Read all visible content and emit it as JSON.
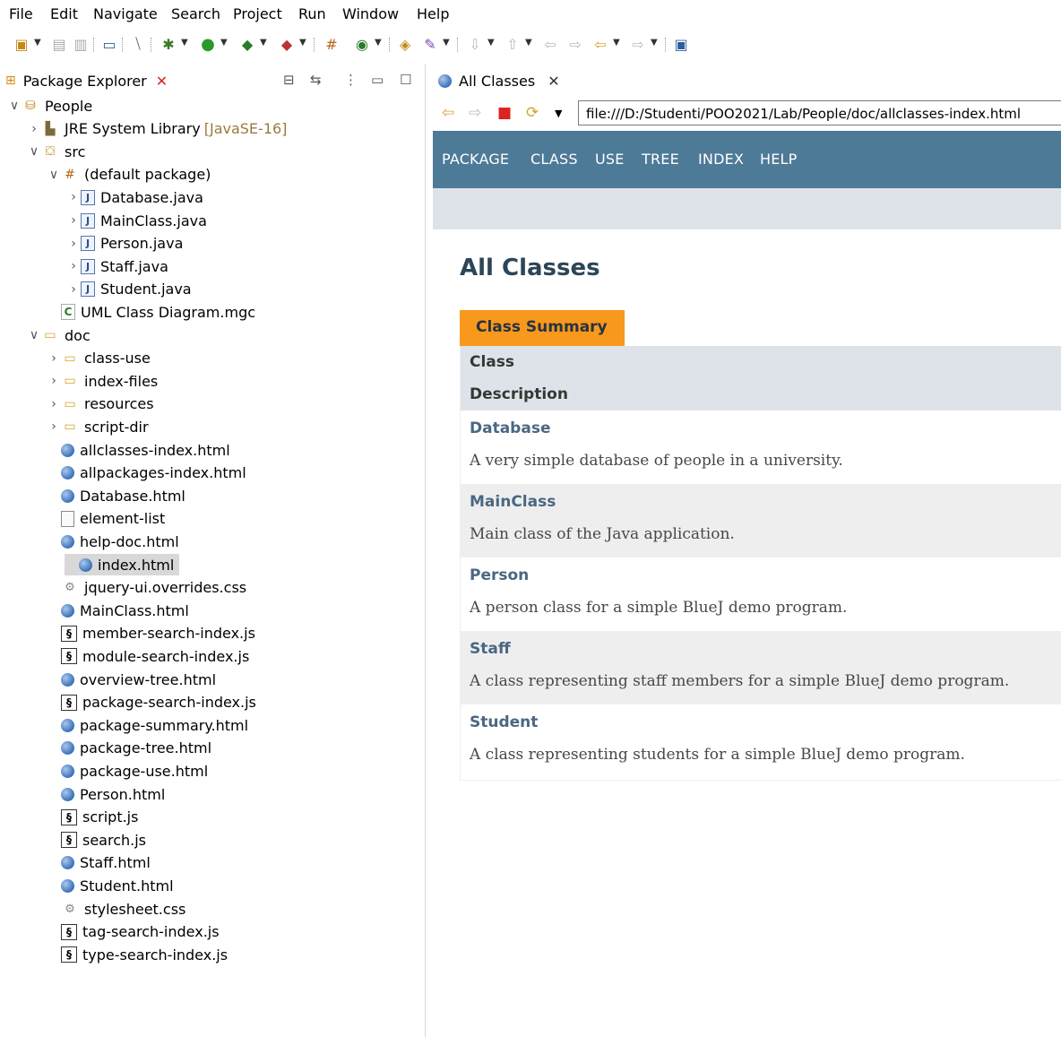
{
  "menu": [
    "File",
    "Edit",
    "Navigate",
    "Search",
    "Project",
    "Run",
    "Window",
    "Help"
  ],
  "package_explorer": {
    "title": "Package Explorer",
    "close": "✕",
    "tree": [
      {
        "label": "People",
        "icon": "project-icon",
        "depth": 0,
        "chevron": "expanded"
      },
      {
        "label": "JRE System Library",
        "extra": "[JavaSE-16]",
        "icon": "library-icon",
        "depth": 1,
        "chevron": "collapsed"
      },
      {
        "label": "src",
        "icon": "source-folder-icon",
        "depth": 1,
        "chevron": "expanded"
      },
      {
        "label": "(default package)",
        "icon": "package-icon",
        "depth": 2,
        "chevron": "expanded"
      },
      {
        "label": "Database.java",
        "icon": "java-file-icon",
        "depth": 3,
        "chevron": "collapsed"
      },
      {
        "label": "MainClass.java",
        "icon": "java-file-icon",
        "depth": 3,
        "chevron": "collapsed"
      },
      {
        "label": "Person.java",
        "icon": "java-file-icon",
        "depth": 3,
        "chevron": "collapsed"
      },
      {
        "label": "Staff.java",
        "icon": "java-file-icon",
        "depth": 3,
        "chevron": "collapsed"
      },
      {
        "label": "Student.java",
        "icon": "java-file-icon",
        "depth": 3,
        "chevron": "collapsed"
      },
      {
        "label": "UML Class Diagram.mgc",
        "icon": "diagram-file-icon",
        "depth": 2,
        "chevron": "none"
      },
      {
        "label": "doc",
        "icon": "folder-icon",
        "depth": 1,
        "chevron": "expanded"
      },
      {
        "label": "class-use",
        "icon": "folder-icon",
        "depth": 2,
        "chevron": "collapsed"
      },
      {
        "label": "index-files",
        "icon": "folder-icon",
        "depth": 2,
        "chevron": "collapsed"
      },
      {
        "label": "resources",
        "icon": "folder-icon",
        "depth": 2,
        "chevron": "collapsed"
      },
      {
        "label": "script-dir",
        "icon": "folder-icon",
        "depth": 2,
        "chevron": "collapsed"
      },
      {
        "label": "allclasses-index.html",
        "icon": "html-file-icon",
        "depth": 2,
        "chevron": "none"
      },
      {
        "label": "allpackages-index.html",
        "icon": "html-file-icon",
        "depth": 2,
        "chevron": "none"
      },
      {
        "label": "Database.html",
        "icon": "html-file-icon",
        "depth": 2,
        "chevron": "none"
      },
      {
        "label": "element-list",
        "icon": "text-file-icon",
        "depth": 2,
        "chevron": "none"
      },
      {
        "label": "help-doc.html",
        "icon": "html-file-icon",
        "depth": 2,
        "chevron": "none"
      },
      {
        "label": "index.html",
        "icon": "html-file-icon",
        "depth": 2,
        "chevron": "none",
        "selected": true
      },
      {
        "label": "jquery-ui.overrides.css",
        "icon": "css-file-icon",
        "depth": 2,
        "chevron": "none"
      },
      {
        "label": "MainClass.html",
        "icon": "html-file-icon",
        "depth": 2,
        "chevron": "none"
      },
      {
        "label": "member-search-index.js",
        "icon": "js-file-icon",
        "depth": 2,
        "chevron": "none"
      },
      {
        "label": "module-search-index.js",
        "icon": "js-file-icon",
        "depth": 2,
        "chevron": "none"
      },
      {
        "label": "overview-tree.html",
        "icon": "html-file-icon",
        "depth": 2,
        "chevron": "none"
      },
      {
        "label": "package-search-index.js",
        "icon": "js-file-icon",
        "depth": 2,
        "chevron": "none"
      },
      {
        "label": "package-summary.html",
        "icon": "html-file-icon",
        "depth": 2,
        "chevron": "none"
      },
      {
        "label": "package-tree.html",
        "icon": "html-file-icon",
        "depth": 2,
        "chevron": "none"
      },
      {
        "label": "package-use.html",
        "icon": "html-file-icon",
        "depth": 2,
        "chevron": "none"
      },
      {
        "label": "Person.html",
        "icon": "html-file-icon",
        "depth": 2,
        "chevron": "none"
      },
      {
        "label": "script.js",
        "icon": "js-file-icon",
        "depth": 2,
        "chevron": "none"
      },
      {
        "label": "search.js",
        "icon": "js-file-icon",
        "depth": 2,
        "chevron": "none"
      },
      {
        "label": "Staff.html",
        "icon": "html-file-icon",
        "depth": 2,
        "chevron": "none"
      },
      {
        "label": "Student.html",
        "icon": "html-file-icon",
        "depth": 2,
        "chevron": "none"
      },
      {
        "label": "stylesheet.css",
        "icon": "css-file-icon",
        "depth": 2,
        "chevron": "none"
      },
      {
        "label": "tag-search-index.js",
        "icon": "js-file-icon",
        "depth": 2,
        "chevron": "none"
      },
      {
        "label": "type-search-index.js",
        "icon": "js-file-icon",
        "depth": 2,
        "chevron": "none"
      }
    ]
  },
  "browser": {
    "tab_title": "All Classes",
    "tab_close": "✕",
    "url": "file:///D:/Studenti/POO2021/Lab/People/doc/allclasses-index.html",
    "nav_links": [
      "PACKAGE",
      "CLASS",
      "USE",
      "TREE",
      "INDEX",
      "HELP"
    ],
    "page_title": "All Classes",
    "caption": "Class Summary",
    "col_class": "Class",
    "col_description": "Description",
    "classes": [
      {
        "name": "Database",
        "description": "A very simple database of people in a university."
      },
      {
        "name": "MainClass",
        "description": "Main class of the Java application."
      },
      {
        "name": "Person",
        "description": "A person class for a simple BlueJ demo program."
      },
      {
        "name": "Staff",
        "description": "A class representing staff members for a simple BlueJ demo program."
      },
      {
        "name": "Student",
        "description": "A class representing students for a simple BlueJ demo program."
      }
    ]
  },
  "colors": {
    "javadoc_nav": "#4d7a97",
    "javadoc_caption": "#f8981d",
    "javadoc_header": "#dee3e9",
    "javadoc_link": "#4a6782"
  }
}
